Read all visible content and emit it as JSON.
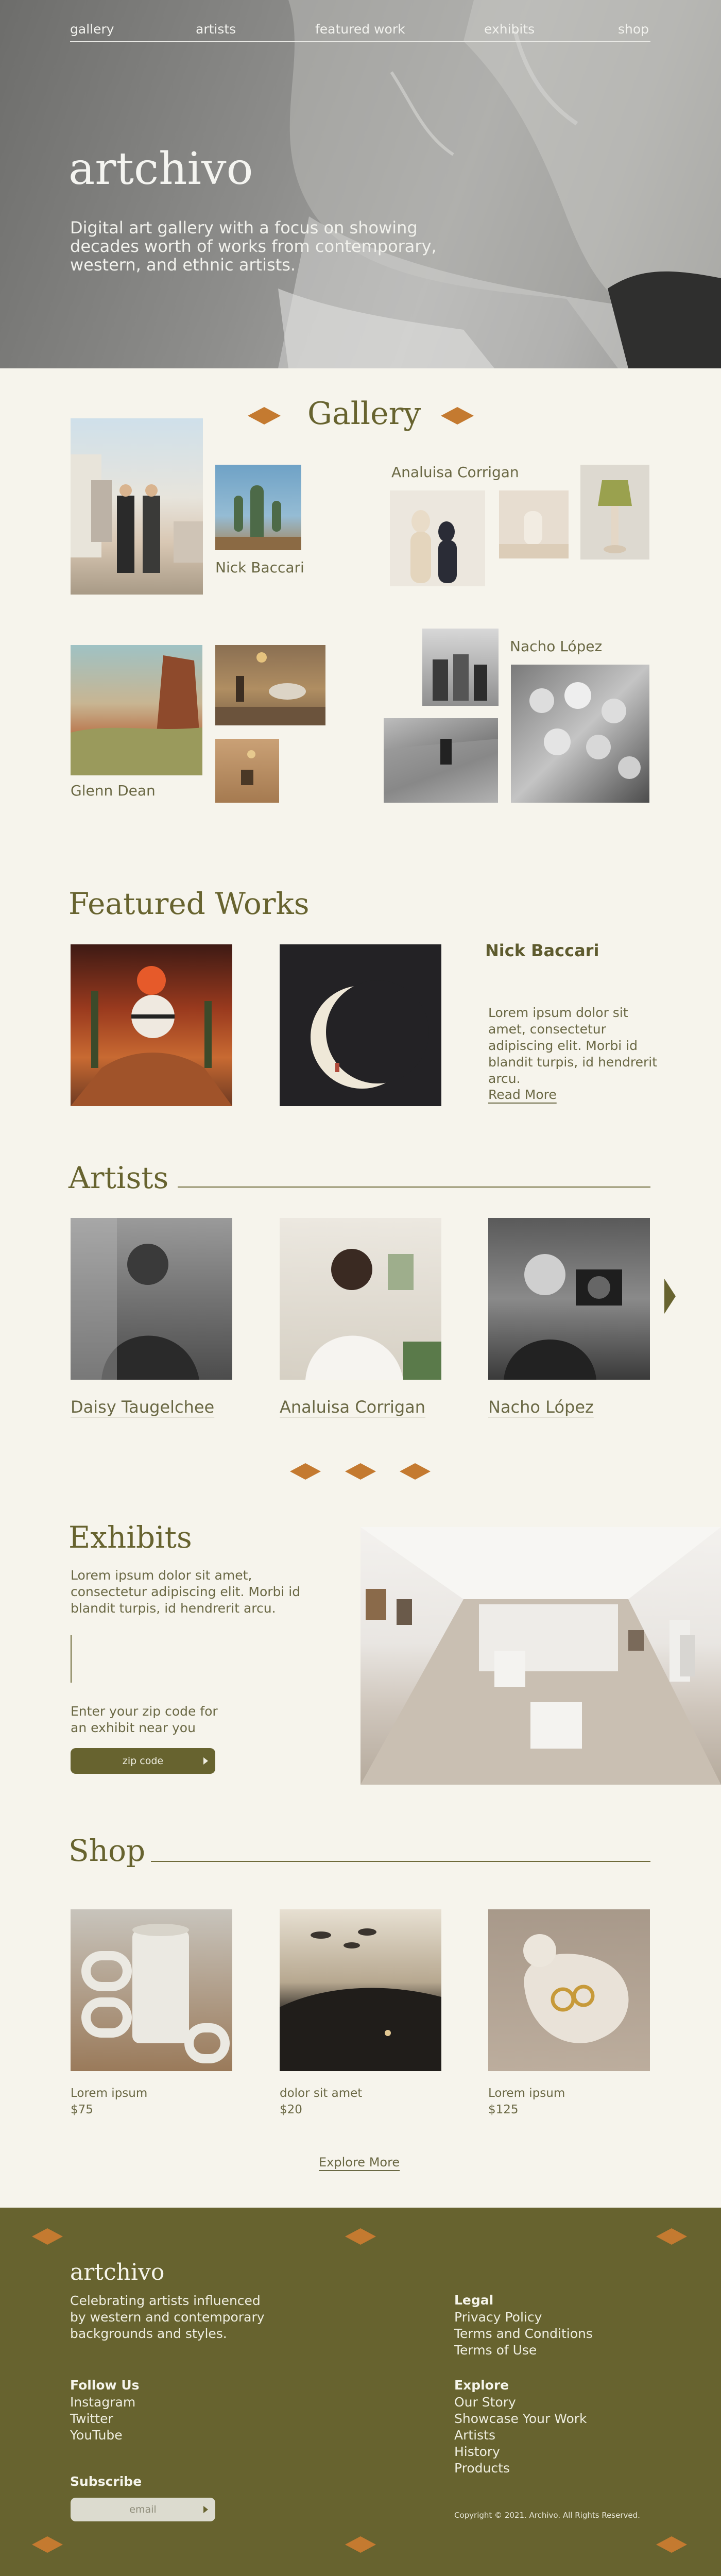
{
  "nav": {
    "items": [
      "gallery",
      "artists",
      "featured work",
      "exhibits",
      "shop"
    ]
  },
  "hero": {
    "title": "artchivo",
    "description": "Digital art gallery with a focus on showing decades worth of works from contemporary, western, and ethnic artists."
  },
  "gallery": {
    "heading": "Gallery",
    "artists": [
      "Nick Baccari",
      "Analuisa Corrigan",
      "Glenn Dean",
      "Nacho López"
    ]
  },
  "featured": {
    "heading": "Featured Works",
    "artist": "Nick Baccari",
    "description": "Lorem ipsum dolor sit amet, consectetur adipiscing elit. Morbi id blandit turpis, id hendrerit arcu.",
    "read_more": "Read More"
  },
  "artists": {
    "heading": "Artists",
    "items": [
      "Daisy Taugelchee",
      "Analuisa Corrigan",
      "Nacho López"
    ]
  },
  "exhibits": {
    "heading": "Exhibits",
    "description": "Lorem ipsum dolor sit amet, consectetur adipiscing elit. Morbi id blandit turpis, id hendrerit arcu.",
    "zip_prompt": "Enter your zip code for an exhibit near you",
    "zip_placeholder": "zip code"
  },
  "shop": {
    "heading": "Shop",
    "items": [
      {
        "name": "Lorem ipsum",
        "price": "$75"
      },
      {
        "name": "dolor sit amet",
        "price": "$20"
      },
      {
        "name": "Lorem ipsum",
        "price": "$125"
      }
    ],
    "explore_more": "Explore More"
  },
  "footer": {
    "title": "artchivo",
    "tagline": "Celebrating artists influenced by western and contemporary backgrounds and styles.",
    "follow_heading": "Follow Us",
    "follow_items": [
      "Instagram",
      "Twitter",
      "YouTube"
    ],
    "legal_heading": "Legal",
    "legal_items": [
      "Privacy Policy",
      "Terms and Conditions",
      "Terms of Use"
    ],
    "explore_heading": "Explore",
    "explore_items": [
      "Our Story",
      "Showcase Your Work",
      "Artists",
      "History",
      "Products"
    ],
    "subscribe_heading": "Subscribe",
    "email_placeholder": "email",
    "copyright": "Copyright © 2021. Archivo. All Rights Reserved."
  },
  "colors": {
    "accent": "#c47a30",
    "olive": "#67632f",
    "background": "#f6f4ec"
  }
}
